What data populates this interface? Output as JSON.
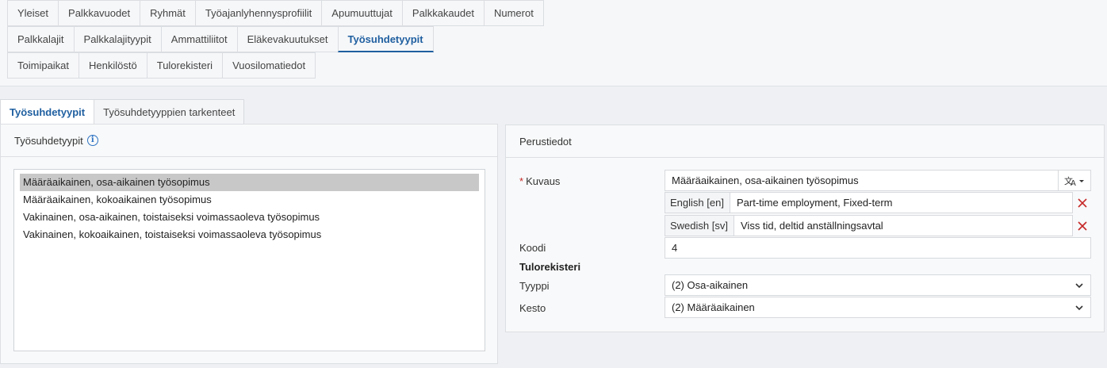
{
  "topnav": {
    "rows": [
      [
        "Yleiset",
        "Palkkavuodet",
        "Ryhmät",
        "Työajanlyhennysprofiilit",
        "Apumuuttujat",
        "Palkkakaudet",
        "Numerot"
      ],
      [
        "Palkkalajit",
        "Palkkalajityypit",
        "Ammattiliitot",
        "Eläkevakuutukset",
        "Työsuhdetyypit"
      ],
      [
        "Toimipaikat",
        "Henkilöstö",
        "Tulorekisteri",
        "Vuosilomatiedot"
      ]
    ],
    "active": "Työsuhdetyypit"
  },
  "subtabs": {
    "tab1": "Työsuhdetyypit",
    "tab2": "Työsuhdetyyppien tarkenteet"
  },
  "left_panel": {
    "title": "Työsuhdetyypit",
    "info_icon": "info-icon",
    "items": [
      "Määräaikainen, osa-aikainen työsopimus",
      "Määräaikainen, kokoaikainen työsopimus",
      "Vakinainen, osa-aikainen, toistaiseksi voimassaoleva työsopimus",
      "Vakinainen, kokoaikainen, toistaiseksi voimassaoleva työsopimus"
    ],
    "selected_index": 0
  },
  "right_panel": {
    "title": "Perustiedot",
    "kuvaus_required": "*",
    "kuvaus_label": "Kuvaus",
    "kuvaus_value": "Määräaikainen, osa-aikainen työsopimus",
    "translate_icon": "translate-icon",
    "translations": [
      {
        "lang": "English [en]",
        "value": "Part-time employment, Fixed-term"
      },
      {
        "lang": "Swedish [sv]",
        "value": "Viss tid, deltid anställningsavtal"
      }
    ],
    "koodi_label": "Koodi",
    "koodi_value": "4",
    "section_title": "Tulorekisteri",
    "tyyppi_label": "Tyyppi",
    "tyyppi_value": "(2) Osa-aikainen",
    "kesto_label": "Kesto",
    "kesto_value": "(2) Määräaikainen"
  },
  "colors": {
    "accent": "#1f5fa0",
    "delete": "#c62828"
  }
}
